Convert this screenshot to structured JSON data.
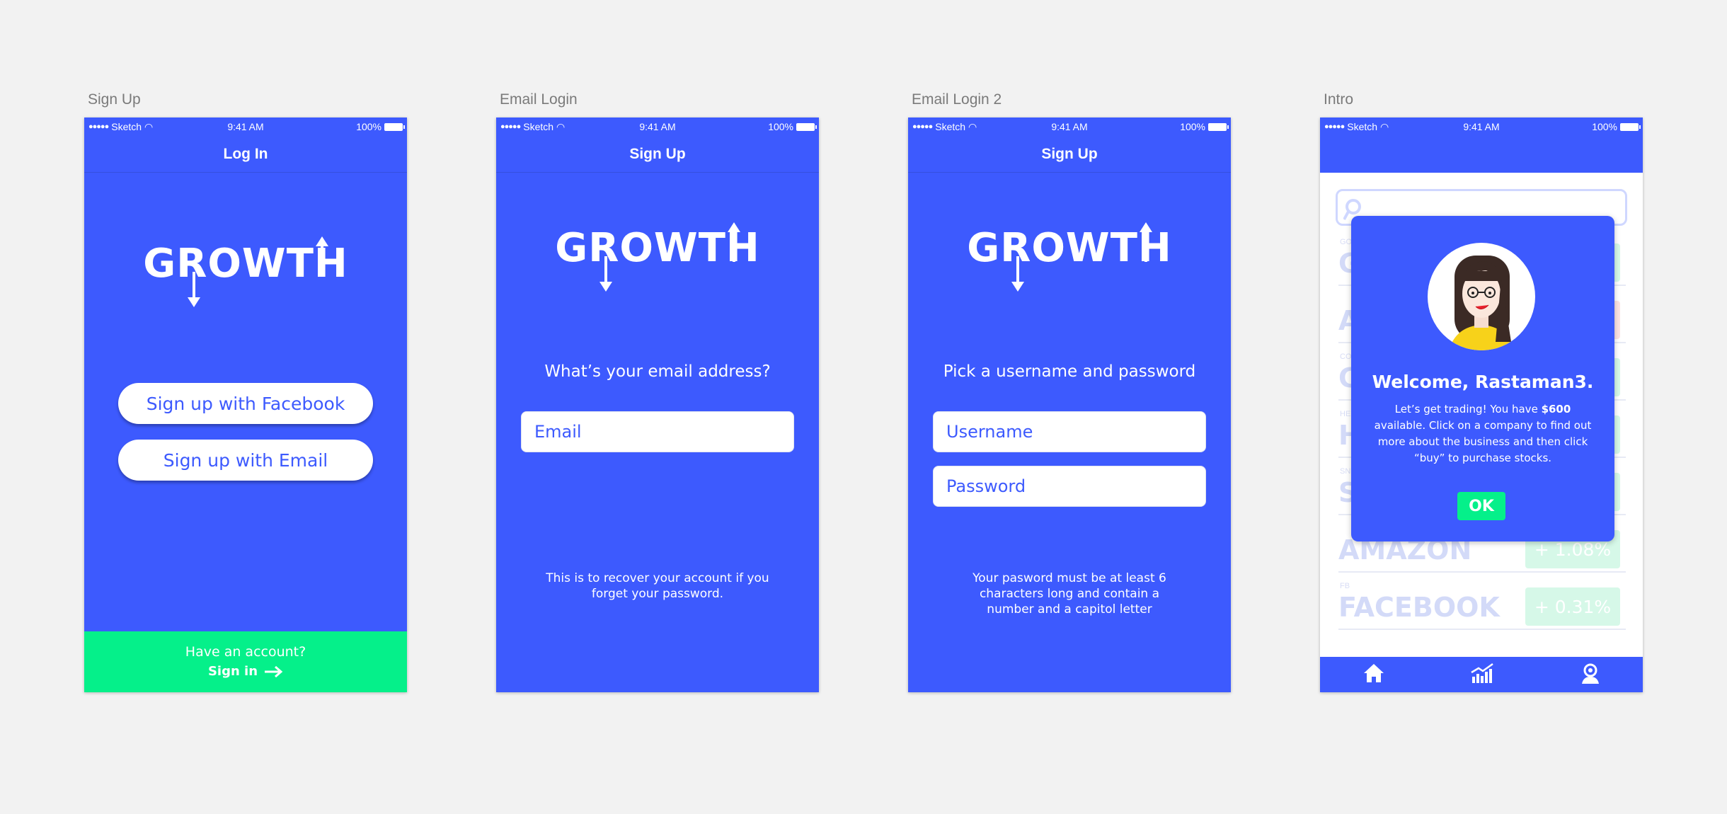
{
  "colors": {
    "brand_blue": "#3d5afe",
    "accent_green": "#05f08a",
    "canvas_bg": "#f2f2f2"
  },
  "status_bar": {
    "carrier": "Sketch",
    "time": "9:41 AM",
    "battery": "100%"
  },
  "logo_text": "GROWTH",
  "screens": {
    "sign_up": {
      "artboard_label": "Sign Up",
      "nav_title": "Log In",
      "facebook_button": "Sign up with Facebook",
      "email_button": "Sign up with Email",
      "footer_question": "Have an account?",
      "footer_link": "Sign in"
    },
    "email_login": {
      "artboard_label": "Email Login",
      "nav_title": "Sign Up",
      "question": "What’s your email address?",
      "email_placeholder": "Email",
      "helper_text": "This is to recover your account if you forget your password."
    },
    "email_login_2": {
      "artboard_label": "Email Login 2",
      "nav_title": "Sign Up",
      "question": "Pick a username and password",
      "username_placeholder": "Username",
      "password_placeholder": "Password",
      "helper_text": "Your pasword must be at least 6 characters long and contain a number and a capitol letter"
    },
    "intro": {
      "artboard_label": "Intro",
      "stocks": [
        {
          "ticker": "GO",
          "name": "G",
          "change": "",
          "color": "#d6f8e8"
        },
        {
          "ticker": "",
          "name": "A",
          "change": "",
          "color": "#fde3e3"
        },
        {
          "ticker": "CO",
          "name": "C",
          "change": "",
          "color": "#d6f8e8"
        },
        {
          "ticker": "HE",
          "name": "H",
          "change": "",
          "color": "#d6f8e8"
        },
        {
          "ticker": "SN",
          "name": "S",
          "change": "",
          "color": "#d6f8e8"
        },
        {
          "ticker": "",
          "name": "AMAZON",
          "change": "+ 1.08%",
          "color": "#d6f8e8"
        },
        {
          "ticker": "FB",
          "name": "FACEBOOK",
          "change": "+ 0.31%",
          "color": "#d6f8e8"
        }
      ],
      "modal": {
        "welcome": "Welcome, Rastaman3.",
        "msg_before": "Let’s get trading! You have ",
        "msg_amount": "$600",
        "msg_after": " available. Click on a company to find out more about the business and then click “buy” to purchase stocks.",
        "ok_label": "OK"
      },
      "tabs": [
        {
          "icon": "home-icon"
        },
        {
          "icon": "chart-icon"
        },
        {
          "icon": "profile-icon"
        }
      ]
    }
  }
}
